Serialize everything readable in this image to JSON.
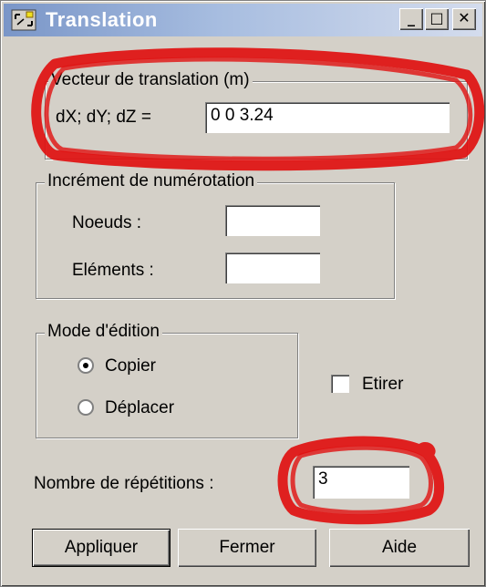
{
  "window": {
    "title": "Translation",
    "controls": {
      "minimize": "_",
      "maximize": "□",
      "close": "✕"
    }
  },
  "translation_vector": {
    "legend": "Vecteur de translation (m)",
    "label": "dX; dY; dZ  =",
    "value": "0 0 3.24"
  },
  "numbering_increment": {
    "legend": "Incrément de numérotation",
    "nodes_label": "Noeuds :",
    "nodes_value": "",
    "elements_label": "Eléments :",
    "elements_value": ""
  },
  "edit_mode": {
    "legend": "Mode d'édition",
    "options": [
      {
        "label": "Copier",
        "selected": true
      },
      {
        "label": "Déplacer",
        "selected": false
      }
    ]
  },
  "stretch": {
    "label": "Etirer",
    "checked": false
  },
  "repetitions": {
    "label": "Nombre de répétitions :",
    "value": "3"
  },
  "buttons": {
    "apply": "Appliquer",
    "close": "Fermer",
    "help": "Aide"
  },
  "colors": {
    "annotation": "#e01010",
    "titlebar_start": "#7a96c8"
  },
  "icons": [
    "translation-app-icon",
    "radio-selected-icon",
    "radio-empty-icon",
    "checkbox-icon"
  ]
}
